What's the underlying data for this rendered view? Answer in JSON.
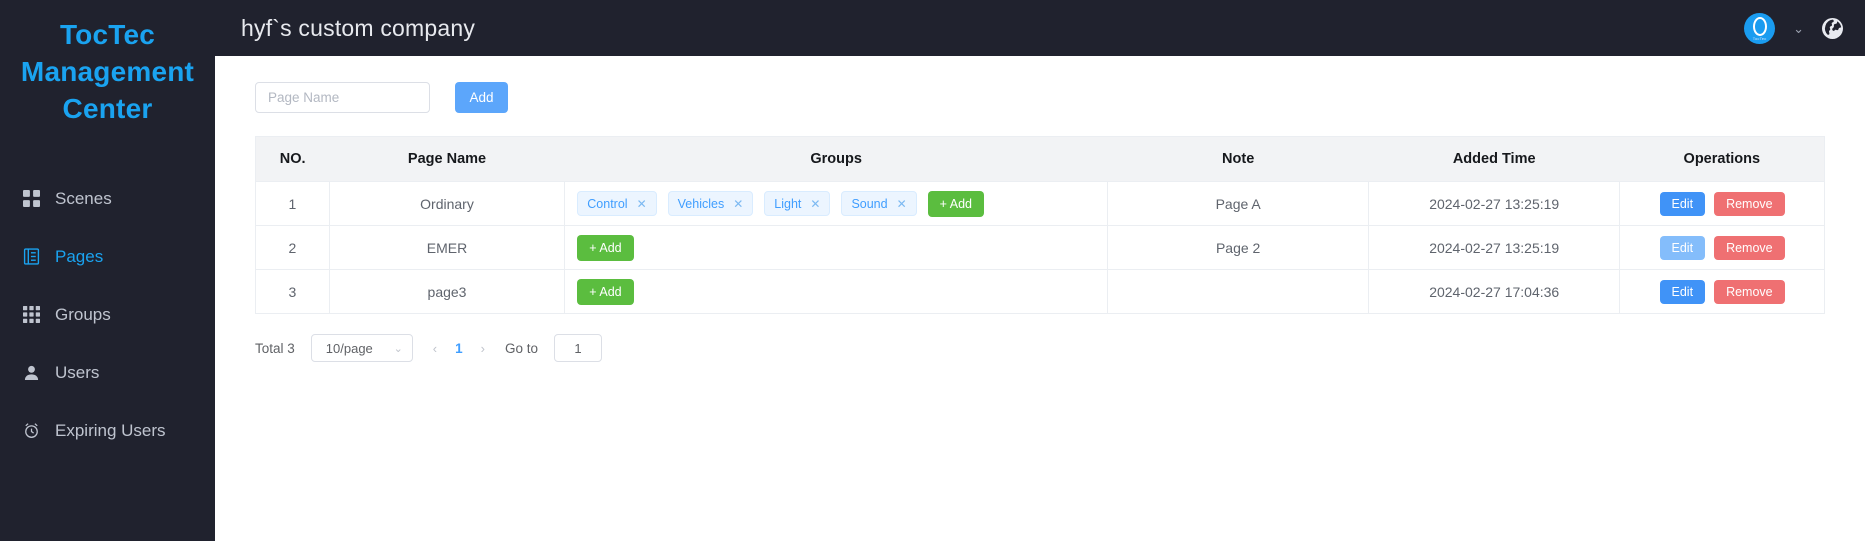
{
  "sidebar": {
    "brand": "TocTec Management Center",
    "items": [
      {
        "label": "Scenes",
        "icon": "grid-2x2-icon",
        "active": false
      },
      {
        "label": "Pages",
        "icon": "document-icon",
        "active": true
      },
      {
        "label": "Groups",
        "icon": "grid-3x3-icon",
        "active": false
      },
      {
        "label": "Users",
        "icon": "user-icon",
        "active": false
      },
      {
        "label": "Expiring Users",
        "icon": "alarm-clock-icon",
        "active": false
      }
    ]
  },
  "topbar": {
    "title": "hyf`s custom company",
    "avatar_text": "TocTec",
    "chevron": "⌄",
    "globe_icon": "globe-icon"
  },
  "search": {
    "placeholder": "Page Name",
    "value": "",
    "add_label": "Add"
  },
  "table": {
    "headers": [
      "NO.",
      "Page Name",
      "Groups",
      "Note",
      "Added Time",
      "Operations"
    ],
    "add_group_label": "+ Add",
    "edit_label": "Edit",
    "remove_label": "Remove",
    "rows": [
      {
        "no": "1",
        "name": "Ordinary",
        "groups": [
          "Control",
          "Vehicles",
          "Light",
          "Sound"
        ],
        "note": "Page A",
        "time": "2024-02-27 13:25:19",
        "edit_hovered": false
      },
      {
        "no": "2",
        "name": "EMER",
        "groups": [],
        "note": "Page 2",
        "time": "2024-02-27 13:25:19",
        "edit_hovered": true
      },
      {
        "no": "3",
        "name": "page3",
        "groups": [],
        "note": "",
        "time": "2024-02-27 17:04:36",
        "edit_hovered": false
      }
    ]
  },
  "pagination": {
    "total": "Total 3",
    "page_size": "10/page",
    "prev": "‹",
    "next": "›",
    "current_page": "1",
    "goto_label": "Go to",
    "goto_value": "1"
  },
  "colors": {
    "sidebar_bg": "#20222e",
    "brand_blue": "#1aa3f0",
    "primary_blue": "#5ca6fb",
    "green": "#5bbd3f",
    "red": "#ef7072",
    "tag_blue": "#409eff"
  }
}
